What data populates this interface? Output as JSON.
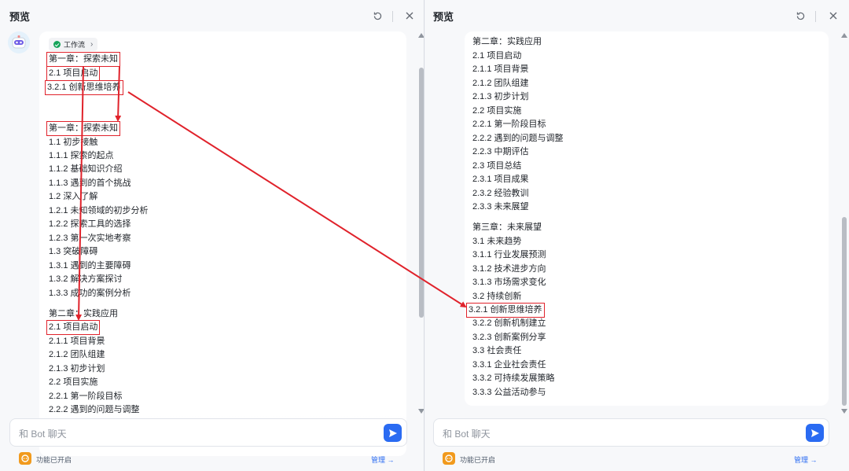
{
  "left": {
    "title": "预览",
    "workflow_label": "工作流",
    "lines_top": [
      "第一章：探索未知",
      "2.1 项目启动",
      "3.2.1 创新思维培养"
    ],
    "lines_ch1": [
      "第一章：探索未知",
      "1.1 初步接触",
      "1.1.1 探索的起点",
      "1.1.2 基础知识介绍",
      "1.1.3 遇到的首个挑战",
      "1.2 深入了解",
      "1.2.1 未知领域的初步分析",
      "1.2.2 探索工具的选择",
      "1.2.3 第一次实地考察",
      "1.3 突破障碍",
      "1.3.1 遇到的主要障碍",
      "1.3.2 解决方案探讨",
      "1.3.3 成功的案例分析"
    ],
    "lines_ch2": [
      "第二章：实践应用",
      "2.1 项目启动",
      "2.1.1 项目背景",
      "2.1.2 团队组建",
      "2.1.3 初步计划",
      "2.2 项目实施",
      "2.2.1 第一阶段目标",
      "2.2.2 遇到的问题与调整"
    ],
    "input_placeholder": "和 Bot 聊天",
    "footer_status": "功能已开启",
    "manage_label": "管理 →"
  },
  "right": {
    "title": "预览",
    "lines_ch2": [
      "第二章：实践应用",
      "2.1 项目启动",
      "2.1.1 项目背景",
      "2.1.2 团队组建",
      "2.1.3 初步计划",
      "2.2 项目实施",
      "2.2.1 第一阶段目标",
      "2.2.2 遇到的问题与调整",
      "2.2.3 中期评估",
      "2.3 项目总结",
      "2.3.1 项目成果",
      "2.3.2 经验教训",
      "2.3.3 未来展望"
    ],
    "lines_ch3": [
      "第三章：未来展望",
      "3.1 未来趋势",
      "3.1.1 行业发展预测",
      "3.1.2 技术进步方向",
      "3.1.3 市场需求变化",
      "3.2 持续创新",
      "3.2.1 创新思维培养",
      "3.2.2 创新机制建立",
      "3.2.3 创新案例分享",
      "3.3 社会责任",
      "3.3.1 企业社会责任",
      "3.3.2 可持续发展策略",
      "3.3.3 公益活动参与"
    ],
    "input_placeholder": "和 Bot 聊天",
    "footer_status": "功能已开启",
    "manage_label": "管理 →"
  },
  "icons": {
    "refresh": "refresh-icon",
    "close": "close-icon",
    "send": "send-icon",
    "bot": "bot-avatar-icon",
    "plugin": "plugin-icon",
    "check": "check-circle-icon"
  },
  "colors": {
    "highlight": "#e0222b",
    "accent": "#2a6bf2",
    "success": "#17a45a"
  }
}
